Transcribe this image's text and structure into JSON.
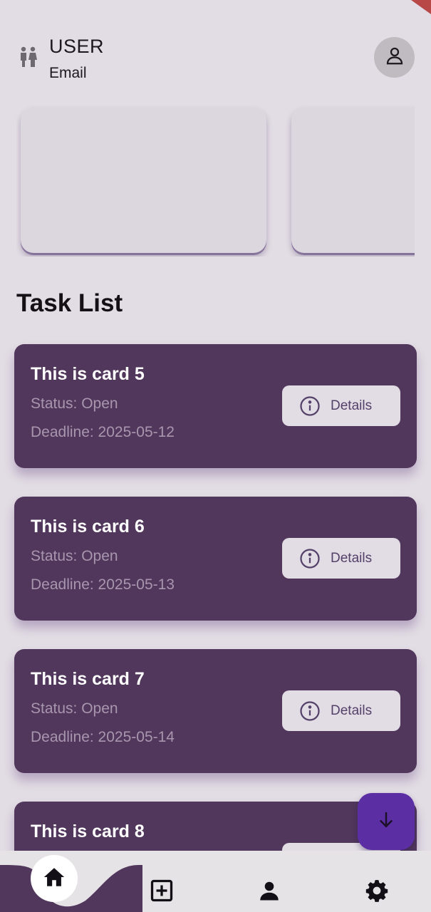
{
  "header": {
    "user_name": "USER",
    "user_email": "Email",
    "user_icon": "people-icon",
    "avatar_icon": "person-outline-icon"
  },
  "carousel": {
    "cards": [
      {},
      {}
    ]
  },
  "task_list": {
    "title": "Task List",
    "details_label": "Details",
    "cards": [
      {
        "title": "This is card 5",
        "status": "Status: Open",
        "deadline": "Deadline: 2025-05-12"
      },
      {
        "title": "This is card 6",
        "status": "Status: Open",
        "deadline": "Deadline: 2025-05-13"
      },
      {
        "title": "This is card 7",
        "status": "Status: Open",
        "deadline": "Deadline: 2025-05-14"
      },
      {
        "title": "This is card 8"
      }
    ]
  },
  "fab": {
    "icon": "arrow-down-icon"
  },
  "bottom_nav": {
    "items": [
      {
        "icon": "home-icon",
        "active": true
      },
      {
        "icon": "add-box-icon"
      },
      {
        "icon": "person-icon"
      },
      {
        "icon": "settings-gear-icon"
      }
    ]
  },
  "colors": {
    "background": "#e2dce4",
    "card": "#51375c",
    "fab": "#5b2fa3",
    "nav_curve": "#51375c",
    "corner_accent": "#b84848"
  }
}
